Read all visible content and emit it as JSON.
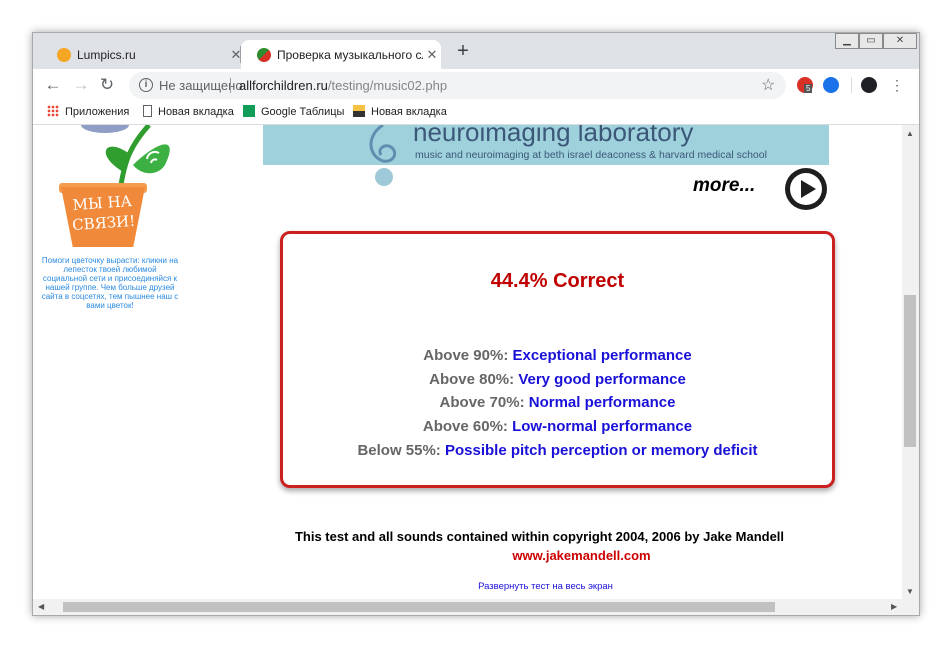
{
  "browser": {
    "tabs": [
      {
        "title": "Lumpics.ru",
        "favicon": "lumpics-favicon"
      },
      {
        "title": "Проверка музыкального слуха",
        "favicon": "test-favicon",
        "active": true
      }
    ],
    "url_security": "Не защищено",
    "url_domain": "allforchildren.ru",
    "url_path": "/testing/music02.php",
    "extension_badge": "5"
  },
  "bookmarks": [
    {
      "label": "Приложения",
      "icon": "apps-grid-icon"
    },
    {
      "label": "Новая вкладка",
      "icon": "page-icon"
    },
    {
      "label": "Google Таблицы",
      "icon": "sheets-icon"
    },
    {
      "label": "Новая вкладка",
      "icon": "image-icon"
    }
  ],
  "widget": {
    "pot_text": "МЫ НА СВЯЗИ!",
    "caption": "Помоги цветочку вырасти: кликни на лепесток твоей любимой социальной сети и присоединяйся к нашей группе. Чем больше друзей сайта в соцсетях, тем пышнее наш с вами цветок!"
  },
  "banner": {
    "title": "neuroimaging laboratory",
    "subtitle": "music and neuroimaging at beth israel deaconess & harvard medical school",
    "more": "more..."
  },
  "result": {
    "score": "44.4% Correct",
    "levels": [
      {
        "threshold": "Above 90%:",
        "desc": "Exceptional performance"
      },
      {
        "threshold": "Above 80%:",
        "desc": "Very good performance"
      },
      {
        "threshold": "Above 70%:",
        "desc": "Normal performance"
      },
      {
        "threshold": "Above 60%:",
        "desc": "Low-normal performance"
      },
      {
        "threshold": "Below 55%:",
        "desc": "Possible pitch perception or memory deficit"
      }
    ]
  },
  "footer": {
    "copyright": "This test and all sounds contained within copyright 2004, 2006 by Jake Mandell",
    "site": "www.jakemandell.com",
    "fullscreen": "Развернуть тест на весь экран"
  },
  "colors": {
    "score": "#c00000",
    "desc": "#1a11d9",
    "threshold": "#666666",
    "box_border": "#cc1f1f"
  }
}
